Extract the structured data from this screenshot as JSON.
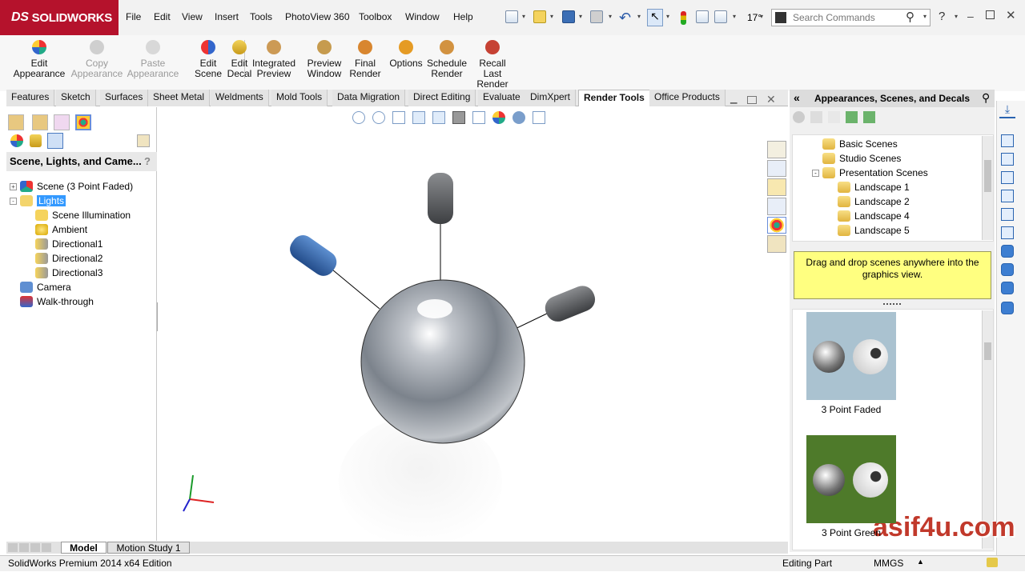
{
  "app": {
    "brand": "SOLIDWORKS",
    "brand_prefix": "DS",
    "accent": "#b5122c"
  },
  "menu": [
    "File",
    "Edit",
    "View",
    "Insert",
    "Tools",
    "PhotoView 360",
    "Toolbox",
    "Window",
    "Help"
  ],
  "quick_access": {
    "zoom_value": "17",
    "zoom_suffix": "°"
  },
  "search": {
    "placeholder": "Search Commands"
  },
  "toolbar_buttons": [
    {
      "label": "Edit\nAppearance",
      "enabled": true,
      "icon": "appearance-icon"
    },
    {
      "label": "Copy\nAppearance",
      "enabled": false,
      "icon": "copy-appearance-icon"
    },
    {
      "label": "Paste\nAppearance",
      "enabled": false,
      "icon": "paste-appearance-icon"
    },
    {
      "label": "Edit\nScene",
      "enabled": true,
      "icon": "scene-icon"
    },
    {
      "label": "Edit\nDecal",
      "enabled": true,
      "icon": "decal-icon"
    },
    {
      "label": "Integrated\nPreview",
      "enabled": true,
      "icon": "integrated-preview-icon"
    },
    {
      "label": "Preview\nWindow",
      "enabled": true,
      "icon": "preview-window-icon"
    },
    {
      "label": "Final\nRender",
      "enabled": true,
      "icon": "final-render-icon"
    },
    {
      "label": "Options",
      "enabled": true,
      "icon": "options-icon"
    },
    {
      "label": "Schedule\nRender",
      "enabled": true,
      "icon": "schedule-render-icon"
    },
    {
      "label": "Recall\nLast\nRender",
      "enabled": true,
      "icon": "recall-render-icon"
    }
  ],
  "tabs": [
    "Features",
    "Sketch",
    "Surfaces",
    "Sheet Metal",
    "Weldments",
    "Mold Tools",
    "Data Migration",
    "Direct Editing",
    "Evaluate",
    "DimXpert",
    "Render Tools",
    "Office Products"
  ],
  "active_tab": "Render Tools",
  "feature_manager": {
    "header": "Scene, Lights, and Came...",
    "help": "?",
    "tree": [
      {
        "label": "Scene (3 Point Faded)",
        "level": 0,
        "icon": "scene-icon",
        "expander": "+"
      },
      {
        "label": "Lights",
        "level": 0,
        "icon": "lights-folder-icon",
        "expander": "-",
        "selected": true
      },
      {
        "label": "Scene Illumination",
        "level": 1,
        "icon": "illumination-icon"
      },
      {
        "label": "Ambient",
        "level": 1,
        "icon": "ambient-bulb-icon"
      },
      {
        "label": "Directional1",
        "level": 1,
        "icon": "directional-light-icon"
      },
      {
        "label": "Directional2",
        "level": 1,
        "icon": "directional-light-icon"
      },
      {
        "label": "Directional3",
        "level": 1,
        "icon": "directional-light-icon"
      },
      {
        "label": "Camera",
        "level": 0,
        "icon": "camera-icon"
      },
      {
        "label": "Walk-through",
        "level": 0,
        "icon": "walkthrough-icon"
      }
    ]
  },
  "task_pane": {
    "title": "Appearances, Scenes, and Decals",
    "tree": [
      {
        "label": "Basic Scenes",
        "level": 0
      },
      {
        "label": "Studio Scenes",
        "level": 0
      },
      {
        "label": "Presentation Scenes",
        "level": 0
      },
      {
        "label": "Landscape 1",
        "level": 1
      },
      {
        "label": "Landscape 2",
        "level": 1
      },
      {
        "label": "Landscape 4",
        "level": 1
      },
      {
        "label": "Landscape 5",
        "level": 1
      }
    ],
    "tip": "Drag and drop scenes anywhere into the graphics view.",
    "thumbnails": [
      {
        "label": "3 Point Faded",
        "bg": "#aac2d0"
      },
      {
        "label": "3 Point Green",
        "bg": "#4e7a2a"
      }
    ]
  },
  "bottom_tabs": [
    "Model",
    "Motion Study 1"
  ],
  "active_bottom_tab": "Model",
  "status": {
    "left": "SolidWorks Premium 2014 x64 Edition",
    "mode": "Editing Part",
    "units": "MMGS"
  },
  "watermark": "asif4u.com"
}
